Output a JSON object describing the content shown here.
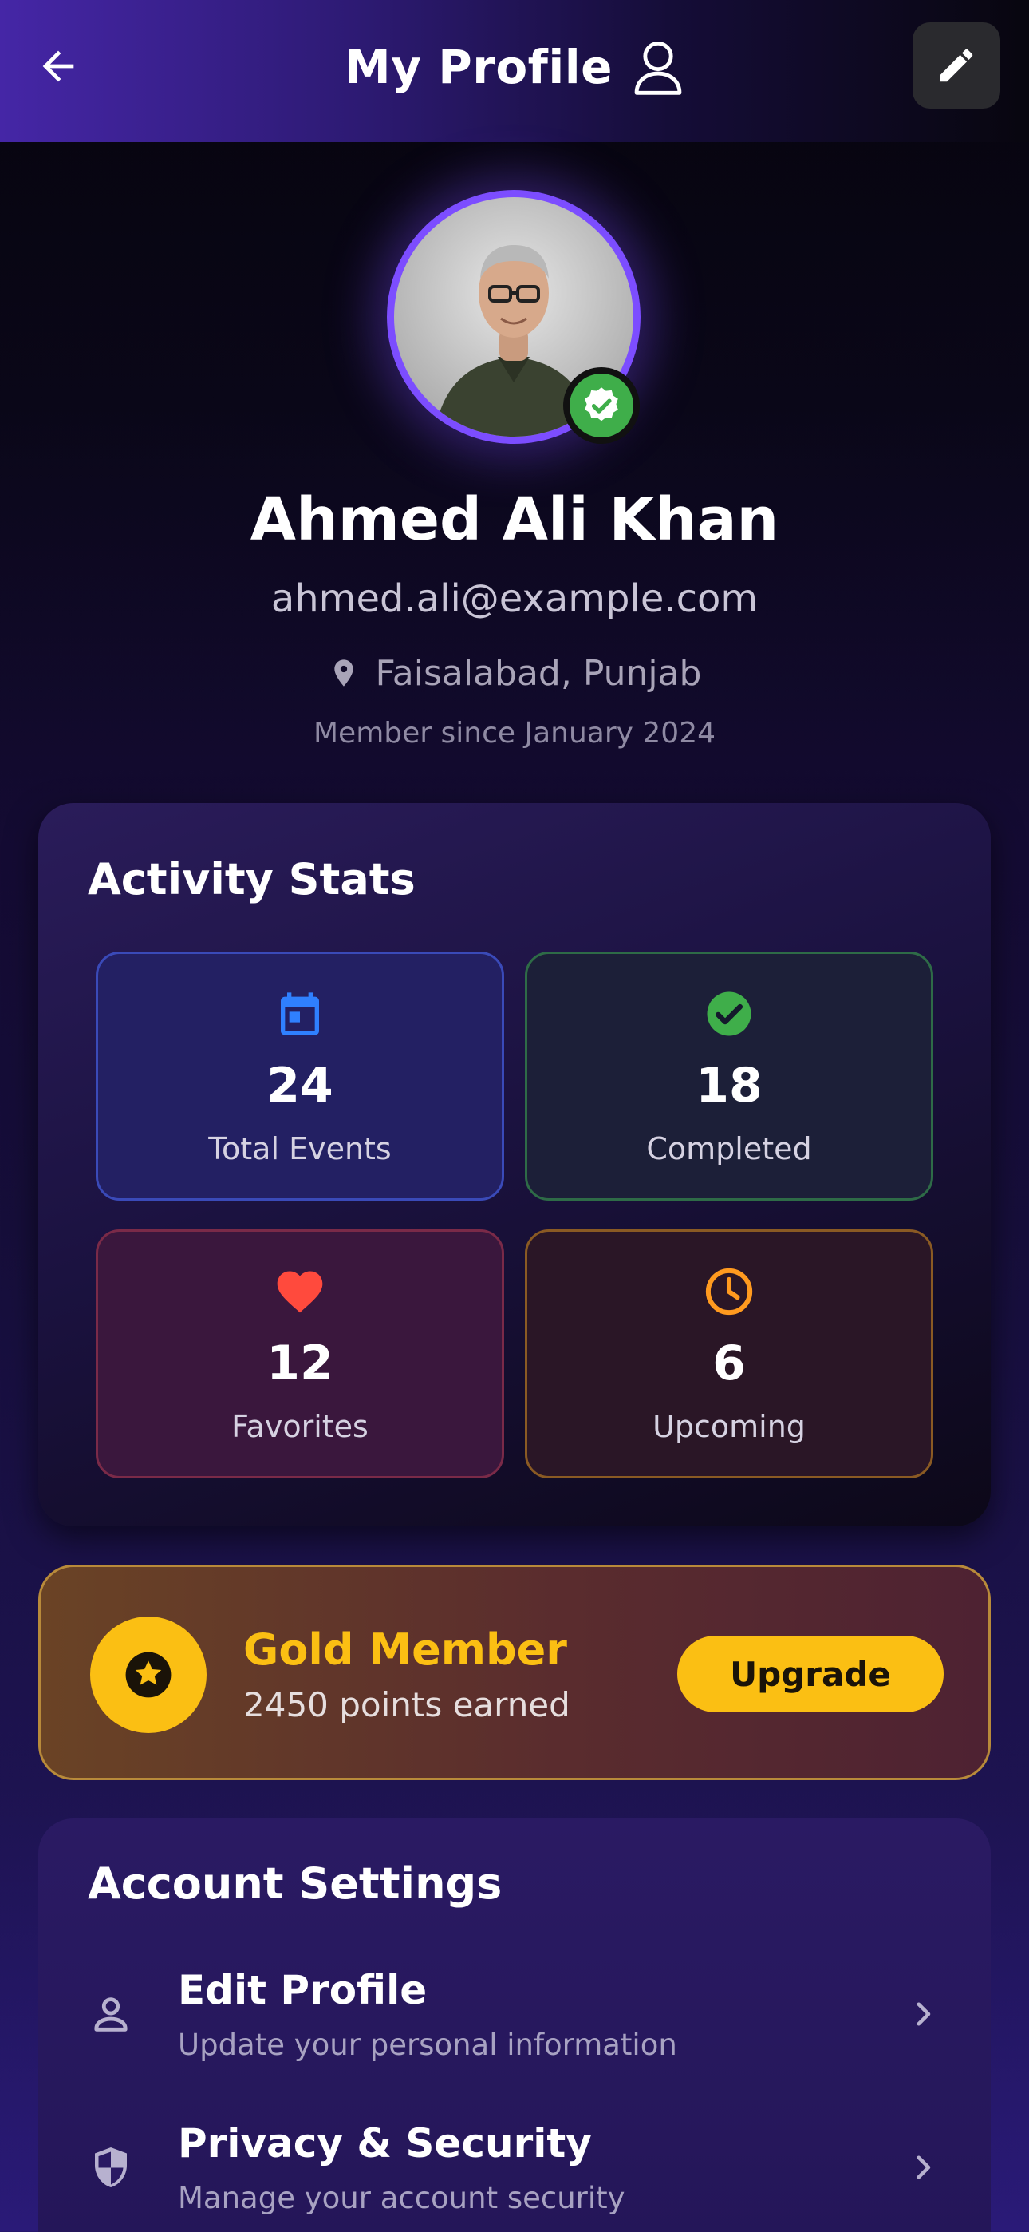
{
  "header": {
    "title": "My Profile",
    "back_icon": "arrow-left-icon",
    "title_icon": "user-outline-icon",
    "edit_icon": "pencil-icon"
  },
  "profile": {
    "name": "Ahmed Ali Khan",
    "email": "ahmed.ali@example.com",
    "location": "Faisalabad, Punjab",
    "member_since": "Member since January 2024",
    "verified": true,
    "accent_color": "#7c4dff"
  },
  "activity": {
    "title": "Activity Stats",
    "stats": [
      {
        "value": "24",
        "label": "Total Events",
        "icon": "calendar-icon",
        "color": "#2f80ff"
      },
      {
        "value": "18",
        "label": "Completed",
        "icon": "check-circle-icon",
        "color": "#3fae4a"
      },
      {
        "value": "12",
        "label": "Favorites",
        "icon": "heart-icon",
        "color": "#ff4a3d"
      },
      {
        "value": "6",
        "label": "Upcoming",
        "icon": "clock-icon",
        "color": "#ff9a1f"
      }
    ]
  },
  "membership": {
    "tier": "Gold Member",
    "points": "2450 points earned",
    "button": "Upgrade",
    "color": "#fbbf13"
  },
  "settings": {
    "title": "Account Settings",
    "items": [
      {
        "title": "Edit Profile",
        "subtitle": "Update your personal information",
        "icon": "person-icon"
      },
      {
        "title": "Privacy & Security",
        "subtitle": "Manage your account security",
        "icon": "shield-icon"
      }
    ]
  }
}
